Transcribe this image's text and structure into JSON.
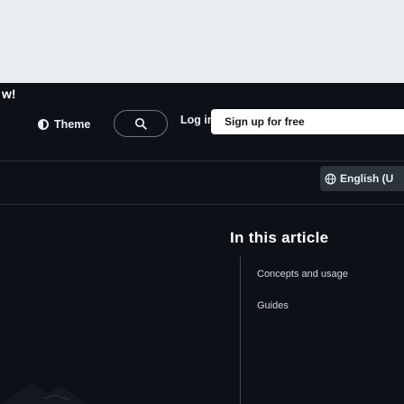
{
  "page": {
    "corner_text": "w!"
  },
  "header": {
    "theme_label": "Theme",
    "login_label": "Log in",
    "signup_label": "Sign up for free"
  },
  "language": {
    "label": "English (U"
  },
  "toc": {
    "title": "In this article",
    "items": [
      {
        "label": "Concepts and usage"
      },
      {
        "label": "Guides"
      }
    ]
  },
  "colors": {
    "background": "#0d1117",
    "top_band": "#e9edf1",
    "signup_bg": "#ffffff",
    "lang_bg": "#2d333b"
  },
  "icons": [
    "theme-icon",
    "search-icon",
    "globe-icon"
  ]
}
